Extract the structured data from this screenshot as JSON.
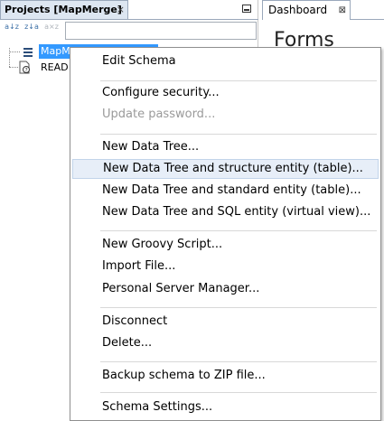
{
  "projects_panel": {
    "tab_title": "Projects [MapMerge]",
    "tab_close": "×",
    "toolbar": {
      "sort_az": "a↓z",
      "sort_za": "z↓a",
      "clear_filter": "a×z"
    },
    "filter_placeholder": "",
    "tree": {
      "selected_node": "MapM",
      "readme_node": "READ"
    }
  },
  "dashboard": {
    "tab_title": "Dashboard",
    "tab_close": "⊠",
    "heading": "Forms"
  },
  "context_menu": {
    "items": [
      {
        "label": "Edit Schema",
        "enabled": true
      },
      {
        "label": "Configure security...",
        "enabled": true
      },
      {
        "label": "Update password...",
        "enabled": false
      },
      {
        "label": "New Data Tree...",
        "enabled": true
      },
      {
        "label": "New Data Tree and structure entity (table)...",
        "enabled": true,
        "hovered": true
      },
      {
        "label": "New Data Tree and standard entity (table)...",
        "enabled": true
      },
      {
        "label": "New Data Tree and SQL entity (virtual view)...",
        "enabled": true
      },
      {
        "label": "New Groovy Script...",
        "enabled": true
      },
      {
        "label": "Import File...",
        "enabled": true
      },
      {
        "label": "Personal Server Manager...",
        "enabled": true
      },
      {
        "label": "Disconnect",
        "enabled": true
      },
      {
        "label": "Delete...",
        "enabled": true
      },
      {
        "label": "Backup schema to ZIP file...",
        "enabled": true
      },
      {
        "label": "Schema Settings...",
        "enabled": true
      }
    ]
  },
  "colors": {
    "selection": "#3399ff",
    "hover_bg": "#e7eef8",
    "disabled_text": "#9a9a9a",
    "tab_bg": "#dde6f1"
  }
}
